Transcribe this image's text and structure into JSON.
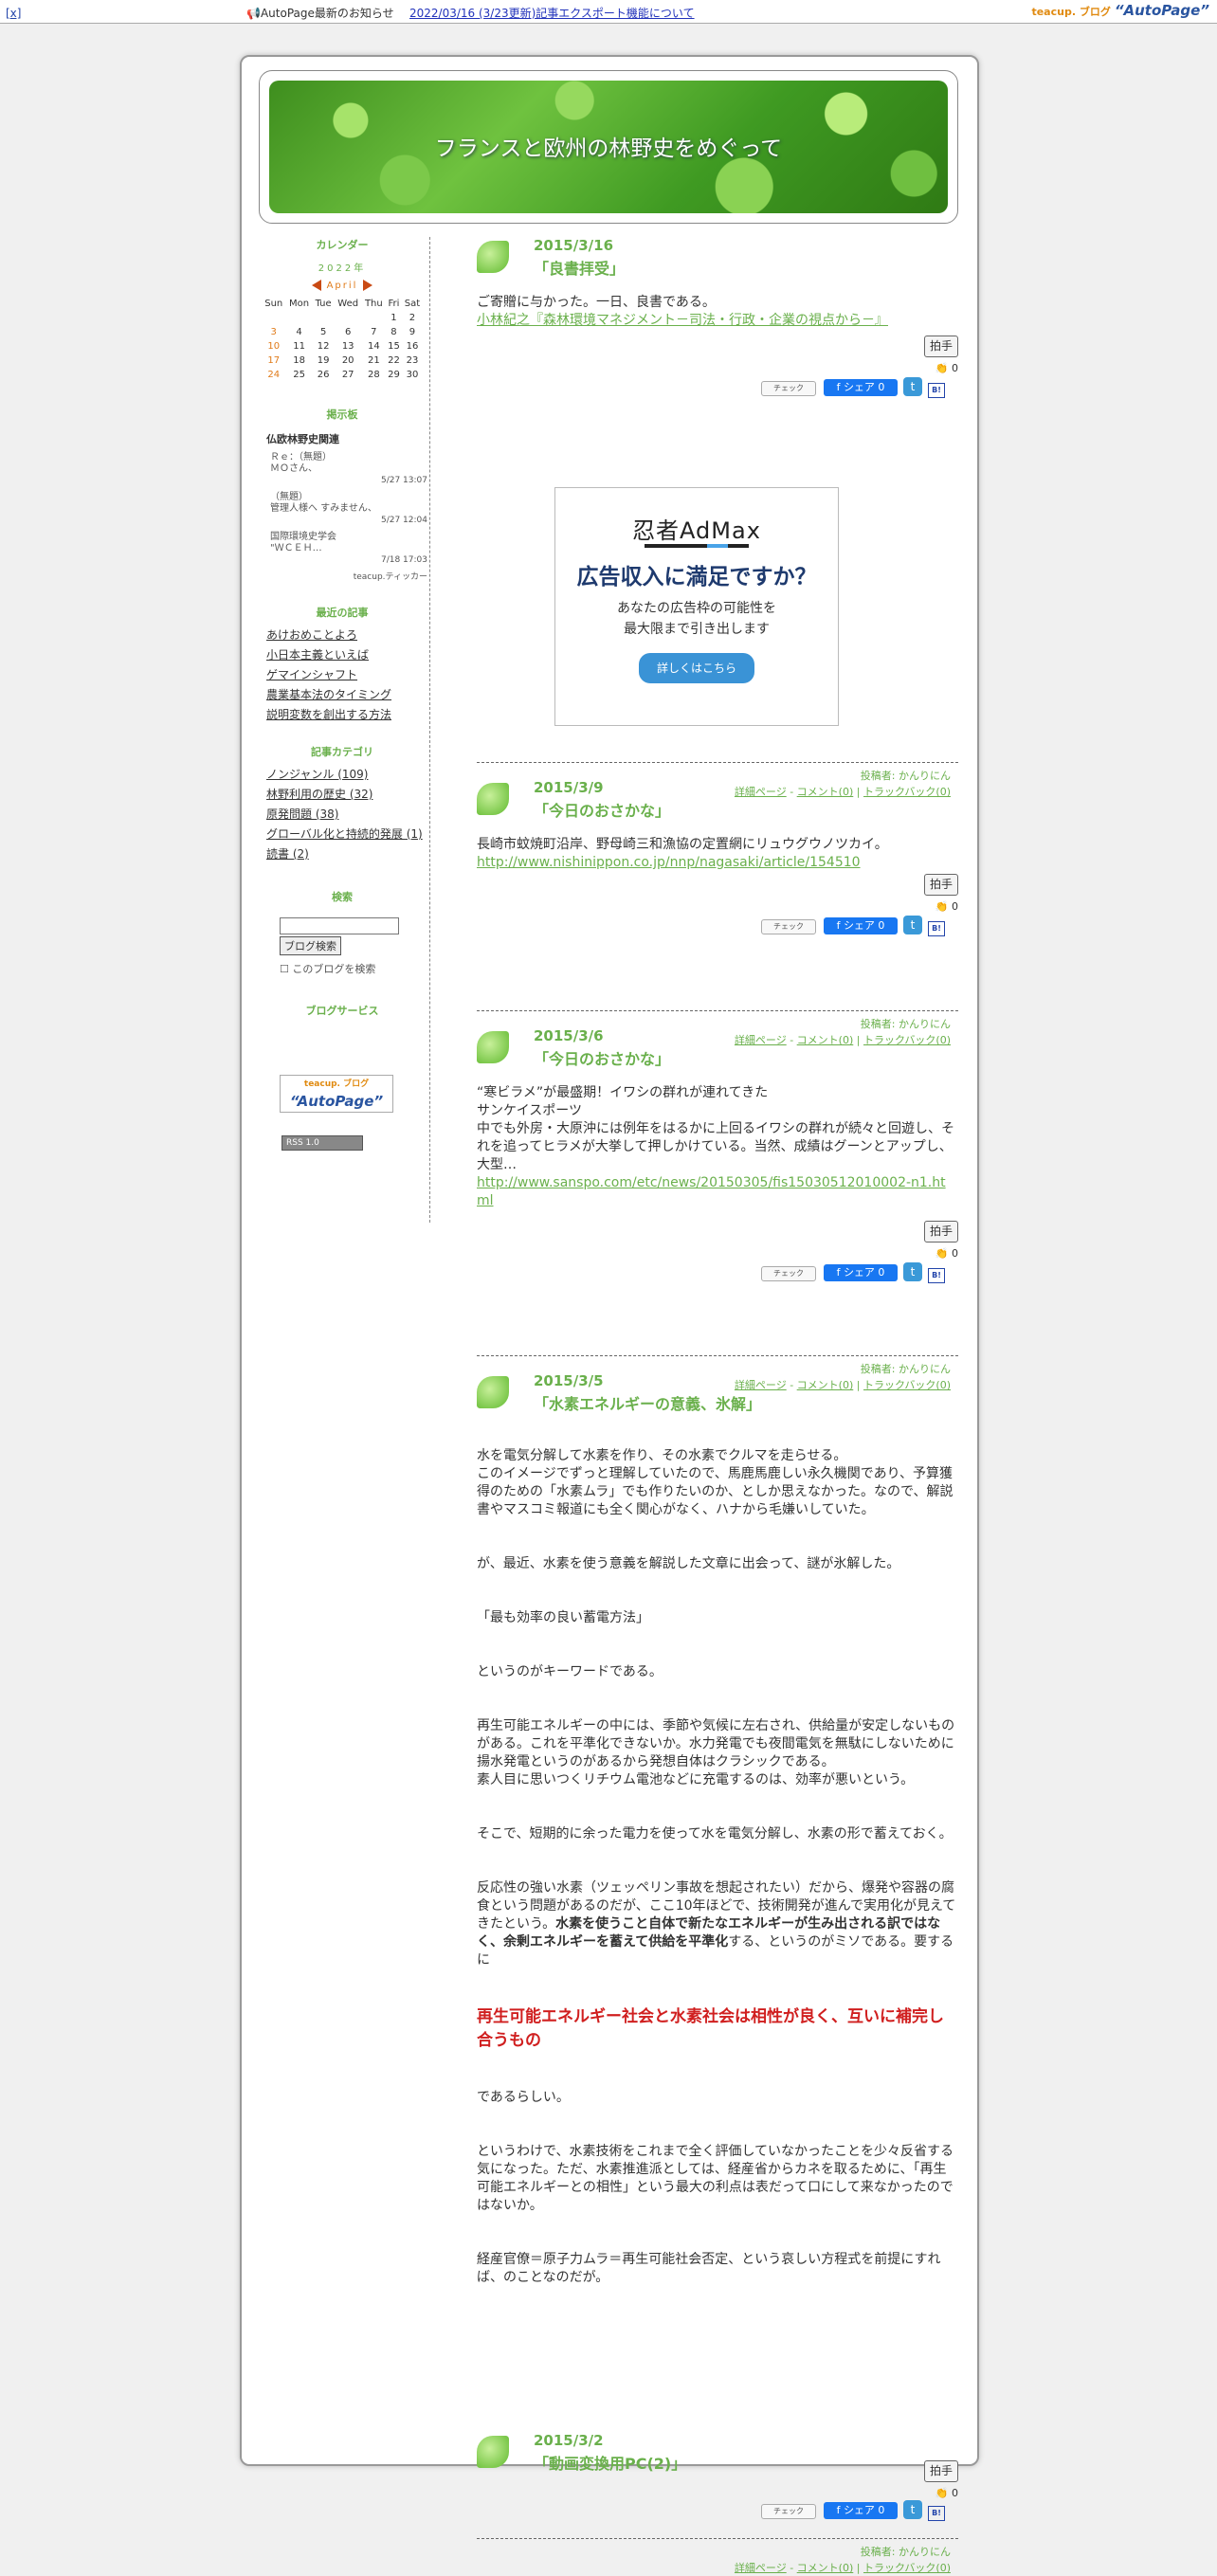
{
  "topbar": {
    "close": "[x]",
    "notice": "AutoPage最新のお知らせ",
    "notice_link": "2022/03/16 (3/23更新)記事エクスポート機能について",
    "brand_small": "teacup. ブログ",
    "brand": "“AutoPage”"
  },
  "header": {
    "title": "フランスと欧州の林野史をめぐって"
  },
  "sidebar": {
    "calendar_heading": "カレンダー",
    "calendar_year": "2022年",
    "calendar_month": "April",
    "weekdays": [
      "Sun",
      "Mon",
      "Tue",
      "Wed",
      "Thu",
      "Fri",
      "Sat"
    ],
    "weeks": [
      [
        "",
        "",
        "",
        "",
        "",
        "1",
        "2"
      ],
      [
        "3",
        "4",
        "5",
        "6",
        "7",
        "8",
        "9"
      ],
      [
        "10",
        "11",
        "12",
        "13",
        "14",
        "15",
        "16"
      ],
      [
        "17",
        "18",
        "19",
        "20",
        "21",
        "22",
        "23"
      ],
      [
        "24",
        "25",
        "26",
        "27",
        "28",
        "29",
        "30"
      ]
    ],
    "bbs_heading": "掲示板",
    "bbs_name": "仏欧林野史関連",
    "bbs_items": [
      {
        "text": "Ｒｅ：（無題）\nＭＯさん、",
        "date": "5/27 13:07"
      },
      {
        "text": "（無題）\n管理人様へ すみません、",
        "date": "5/27 12:04"
      },
      {
        "text": "国際環境史学会\n\"ＷＣＥＨ…",
        "date": "7/18 17:03"
      }
    ],
    "bbs_footer": "teacup.ティッカー",
    "recent_heading": "最近の記事",
    "recent": [
      "あけおめことよろ",
      "小日本主義といえば",
      "ゲマインシャフト",
      "農業基本法のタイミング",
      "説明変数を創出する方法"
    ],
    "category_heading": "記事カテゴリ",
    "categories": [
      "ノンジャンル (109)",
      "林野利用の歴史 (32)",
      "原発問題 (38)",
      "グローバル化と持続的発展 (1)",
      "読書 (2)"
    ],
    "search_heading": "検索",
    "search_button": "ブログ検索",
    "search_checkbox": "このブログを検索",
    "services_heading": "ブログサービス",
    "badge_small": "teacup. ブログ",
    "badge": "“AutoPage”",
    "rss": "RSS 1.0"
  },
  "common": {
    "clap": "拍手",
    "clap_count": "0",
    "check": "チェック",
    "share": "シェア 0",
    "poster": "投稿者: かんりにん",
    "detail": "詳細ページ",
    "comment": "コメント(0)",
    "trackback": "トラックバック(0)"
  },
  "entries": [
    {
      "date": "2015/3/16",
      "title": "「良書拝受」",
      "body1": "ご寄贈に与かった。一日、良書である。",
      "link": "小林紀之『森林環境マネジメント－司法・行政・企業の視点から－』"
    },
    {
      "date": "2015/3/9",
      "title": "「今日のおさかな」",
      "body1": "長崎市蚊焼町沿岸、野母崎三和漁協の定置網にリュウグウノツカイ。",
      "link": "http://www.nishinippon.co.jp/nnp/nagasaki/article/154510"
    },
    {
      "date": "2015/3/6",
      "title": "「今日のおさかな」",
      "body1": "“寒ビラメ”が最盛期！イワシの群れが連れてきた",
      "body2": "サンケイスポーツ",
      "body3": "中でも外房・大原沖には例年をはるかに上回るイワシの群れが続々と回遊し、それを追ってヒラメが大挙して押しかけている。当然、成績はグーンとアップし、大型…",
      "link": "http://www.sanspo.com/etc/news/20150305/fis15030512010002-n1.html"
    },
    {
      "date": "2015/3/5",
      "title": "「水素エネルギーの意義、氷解」",
      "p1": "水を電気分解して水素を作り、その水素でクルマを走らせる。\nこのイメージでずっと理解していたので、馬鹿馬鹿しい永久機関であり、予算獲得のための「水素ムラ」でも作りたいのか、としか思えなかった。なので、解説書やマスコミ報道にも全く関心がなく、ハナから毛嫌いしていた。",
      "p2": "が、最近、水素を使う意義を解説した文章に出会って、謎が氷解した。",
      "p3": "「最も効率の良い蓄電方法」",
      "p4": "というのがキーワードである。",
      "p5": "再生可能エネルギーの中には、季節や気候に左右され、供給量が安定しないものがある。これを平準化できないか。水力発電でも夜間電気を無駄にしないために揚水発電というのがあるから発想自体はクラシックである。\n素人目に思いつくリチウム電池などに充電するのは、効率が悪いという。",
      "p6": "そこで、短期的に余った電力を使って水を電気分解し、水素の形で蓄えておく。",
      "p7a": "反応性の強い水素（ツェッペリン事故を想起されたい）だから、爆発や容器の腐食という問題があるのだが、ここ10年ほどで、技術開発が進んで実用化が見えてきたという。",
      "p7b": "水素を使うこと自体で新たなエネルギーが生み出される訳ではなく、余剰エネルギーを蓄えて供給を平準化",
      "p7c": "する、というのがミソである。要するに",
      "red": "再生可能エネルギー社会と水素社会は相性が良く、互いに補完し合うもの",
      "p8": "であるらしい。",
      "p9": "というわけで、水素技術をこれまで全く評価していなかったことを少々反省する気になった。ただ、水素推進派としては、経産省からカネを取るために、「再生可能エネルギーとの相性」という最大の利点は表だって口にして来なかったのではないか。",
      "p10": "経産官僚＝原子力ムラ＝再生可能社会否定、という哀しい方程式を前提にすれば、のことなのだが。"
    },
    {
      "date": "2015/3/2",
      "title": "「動画変換用PC(2)」"
    }
  ],
  "ad": {
    "logo": "忍者AdMax",
    "headline": "広告収入に満足ですか？",
    "sub1": "あなたの広告枠の可能性を",
    "sub2": "最大限まで引き出します",
    "cta": "詳しくはこちら"
  }
}
